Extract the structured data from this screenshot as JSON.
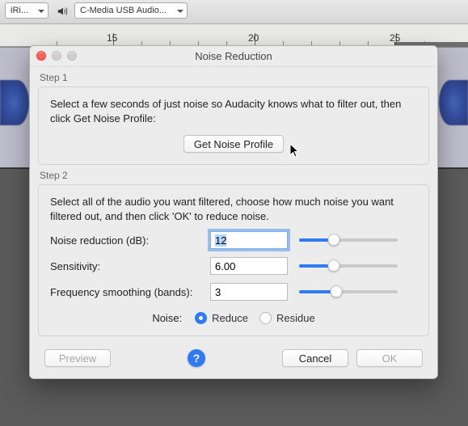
{
  "bg": {
    "dropdown1": "iRi...",
    "dropdown2": "C-Media USB Audio...",
    "ruler": {
      "t15": "15",
      "t20": "20",
      "t25": "25"
    }
  },
  "dialog": {
    "title": "Noise Reduction",
    "step1": {
      "label": "Step 1",
      "instructions": "Select a few seconds of just noise so Audacity knows what to filter out, then click Get Noise Profile:",
      "button": "Get Noise Profile"
    },
    "step2": {
      "label": "Step 2",
      "instructions": "Select all of the audio you want filtered, choose how much noise you want filtered out, and then click 'OK' to reduce noise.",
      "rows": {
        "nr": {
          "label": "Noise reduction (dB):",
          "value": "12",
          "slider": 35
        },
        "sens": {
          "label": "Sensitivity:",
          "value": "6.00",
          "slider": 35
        },
        "freq": {
          "label": "Frequency smoothing (bands):",
          "value": "3",
          "slider": 38
        }
      },
      "noise_label": "Noise:",
      "reduce": "Reduce",
      "residue": "Residue"
    },
    "footer": {
      "preview": "Preview",
      "help": "?",
      "cancel": "Cancel",
      "ok": "OK"
    }
  }
}
